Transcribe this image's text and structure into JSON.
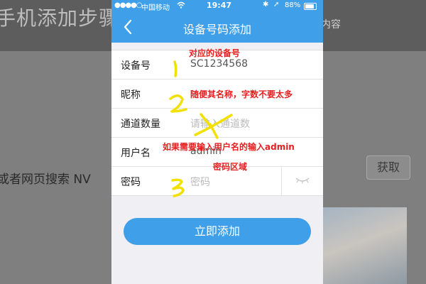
{
  "background": {
    "title": "手机添加步骤",
    "right_text": "内容",
    "left_text": "或者网页搜索 NV",
    "get_button": "获取"
  },
  "status_bar": {
    "carrier": "中国移动",
    "time": "19:47",
    "battery": "88%"
  },
  "nav": {
    "title": "设备号码添加",
    "back_icon": "chevron-left-icon"
  },
  "form": {
    "device_id": {
      "label": "设备号",
      "value": "SC1234568"
    },
    "nickname": {
      "label": "昵称",
      "value": ""
    },
    "channels": {
      "label": "通道数量",
      "placeholder": "请输入通道数"
    },
    "username": {
      "label": "用户名",
      "value": "admin"
    },
    "password": {
      "label": "密码",
      "placeholder": "密码"
    }
  },
  "submit_label": "立即添加",
  "annotations": {
    "device": "对应的设备号",
    "name": "随便其名称，字数不要太多",
    "user_line1": "如果需要输入用户名的输入admin",
    "user_line2": "密码区域"
  },
  "colors": {
    "accent": "#3f9fe8",
    "annotation": "#e62020",
    "mark": "#f2e100"
  }
}
